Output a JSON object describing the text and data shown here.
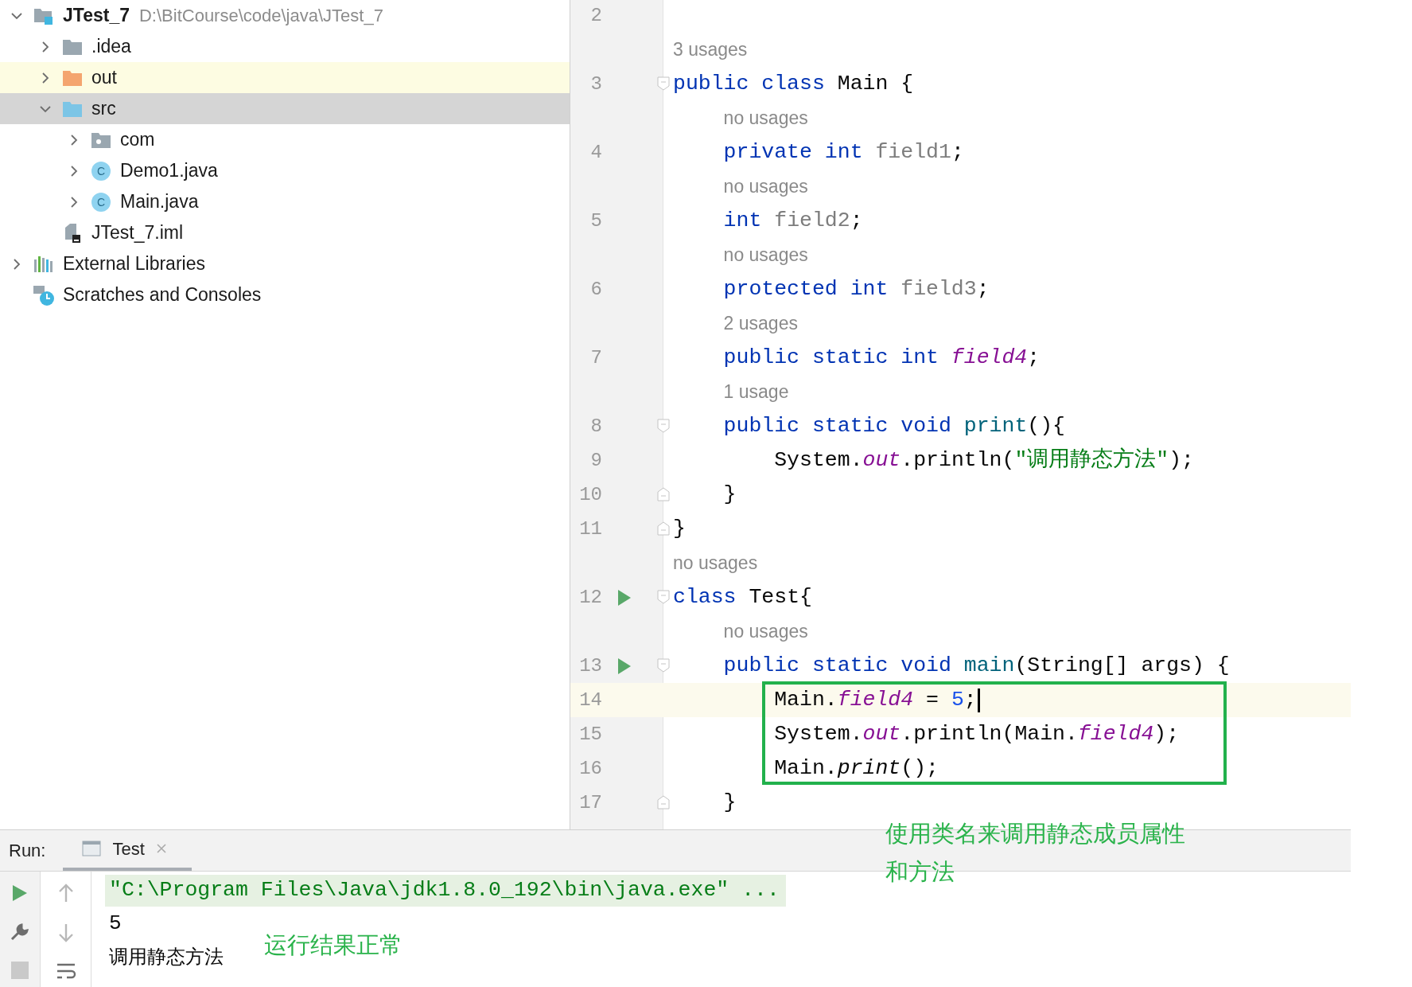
{
  "project_tree": [
    {
      "name": "JTest_7",
      "path": "D:\\BitCourse\\code\\java\\JTest_7",
      "kind": "project",
      "expanded": true,
      "selected": false,
      "highlighted": false,
      "children": [
        {
          "name": ".idea",
          "kind": "folder",
          "expanded": false,
          "selected": false,
          "highlighted": false
        },
        {
          "name": "out",
          "kind": "excluded_folder",
          "expanded": false,
          "selected": false,
          "highlighted": true
        },
        {
          "name": "src",
          "kind": "source_folder",
          "expanded": true,
          "selected": true,
          "children": [
            {
              "name": "com",
              "kind": "package",
              "expanded": false,
              "selected": false,
              "highlighted": false
            },
            {
              "name": "Demo1.java",
              "kind": "class",
              "badge": "C",
              "expanded": false,
              "selected": false,
              "highlighted": false
            },
            {
              "name": "Main.java",
              "kind": "class",
              "badge": "C",
              "expanded": false,
              "selected": false,
              "highlighted": false
            }
          ]
        },
        {
          "name": "JTest_7.iml",
          "kind": "module_file",
          "selected": false,
          "highlighted": false
        }
      ]
    },
    {
      "name": "External Libraries",
      "kind": "libraries",
      "expanded": false,
      "selected": false,
      "highlighted": false
    },
    {
      "name": "Scratches and Consoles",
      "kind": "scratches",
      "selected": false,
      "highlighted": false
    }
  ],
  "editor": {
    "rows": [
      {
        "kind": "code",
        "number": "2",
        "current": false,
        "run_marker": false,
        "tokens": []
      },
      {
        "kind": "hint",
        "text": "3 usages"
      },
      {
        "kind": "code",
        "number": "3",
        "current": false,
        "run_marker": false,
        "fold_start": true,
        "tokens": [
          {
            "text": "public class ",
            "kind": "keyword"
          },
          {
            "text": "Main {",
            "kind": "plain"
          }
        ]
      },
      {
        "kind": "hint",
        "text": "no usages"
      },
      {
        "kind": "code",
        "number": "4",
        "current": false,
        "run_marker": false,
        "tokens": [
          {
            "text": "    private int ",
            "kind": "keyword"
          },
          {
            "text": "field1",
            "kind": "unused"
          },
          {
            "text": ";",
            "kind": "plain"
          }
        ]
      },
      {
        "kind": "hint",
        "text": "no usages"
      },
      {
        "kind": "code",
        "number": "5",
        "current": false,
        "run_marker": false,
        "tokens": [
          {
            "text": "    int ",
            "kind": "keyword"
          },
          {
            "text": "field2",
            "kind": "unused"
          },
          {
            "text": ";",
            "kind": "plain"
          }
        ]
      },
      {
        "kind": "hint",
        "text": "no usages"
      },
      {
        "kind": "code",
        "number": "6",
        "current": false,
        "run_marker": false,
        "tokens": [
          {
            "text": "    protected int ",
            "kind": "keyword"
          },
          {
            "text": "field3",
            "kind": "unused"
          },
          {
            "text": ";",
            "kind": "plain"
          }
        ]
      },
      {
        "kind": "hint",
        "text": "2 usages"
      },
      {
        "kind": "code",
        "number": "7",
        "current": false,
        "run_marker": false,
        "tokens": [
          {
            "text": "    public static int ",
            "kind": "keyword"
          },
          {
            "text": "field4",
            "kind": "static"
          },
          {
            "text": ";",
            "kind": "plain"
          }
        ]
      },
      {
        "kind": "hint",
        "text": "1 usage"
      },
      {
        "kind": "code",
        "number": "8",
        "current": false,
        "run_marker": false,
        "fold_start": true,
        "tokens": [
          {
            "text": "    public static void ",
            "kind": "keyword"
          },
          {
            "text": "print",
            "kind": "method"
          },
          {
            "text": "(){",
            "kind": "plain"
          }
        ]
      },
      {
        "kind": "code",
        "number": "9",
        "current": false,
        "run_marker": false,
        "tokens": [
          {
            "text": "        System.",
            "kind": "plain"
          },
          {
            "text": "out",
            "kind": "static"
          },
          {
            "text": ".println(",
            "kind": "plain"
          },
          {
            "text": "\"调用静态方法\"",
            "kind": "string"
          },
          {
            "text": ");",
            "kind": "plain"
          }
        ]
      },
      {
        "kind": "code",
        "number": "10",
        "current": false,
        "run_marker": false,
        "fold_end": true,
        "tokens": [
          {
            "text": "    }",
            "kind": "plain"
          }
        ]
      },
      {
        "kind": "code",
        "number": "11",
        "current": false,
        "run_marker": false,
        "fold_end": true,
        "tokens": [
          {
            "text": "}",
            "kind": "plain"
          }
        ]
      },
      {
        "kind": "hint",
        "text": "no usages"
      },
      {
        "kind": "code",
        "number": "12",
        "current": false,
        "run_marker": true,
        "fold_start": true,
        "tokens": [
          {
            "text": "class ",
            "kind": "keyword"
          },
          {
            "text": "Test{",
            "kind": "plain"
          }
        ]
      },
      {
        "kind": "hint",
        "text": "no usages"
      },
      {
        "kind": "code",
        "number": "13",
        "current": false,
        "run_marker": true,
        "fold_start": true,
        "tokens": [
          {
            "text": "    public static void ",
            "kind": "keyword"
          },
          {
            "text": "main",
            "kind": "method"
          },
          {
            "text": "(String[] args) {",
            "kind": "plain"
          }
        ]
      },
      {
        "kind": "code",
        "number": "14",
        "current": true,
        "run_marker": false,
        "tokens": [
          {
            "text": "        Main.",
            "kind": "plain"
          },
          {
            "text": "field4",
            "kind": "static"
          },
          {
            "text": " = ",
            "kind": "plain"
          },
          {
            "text": "5",
            "kind": "number"
          },
          {
            "text": ";",
            "kind": "plain"
          }
        ]
      },
      {
        "kind": "code",
        "number": "15",
        "current": false,
        "run_marker": false,
        "tokens": [
          {
            "text": "        System.",
            "kind": "plain"
          },
          {
            "text": "out",
            "kind": "static"
          },
          {
            "text": ".println(Main.",
            "kind": "plain"
          },
          {
            "text": "field4",
            "kind": "static"
          },
          {
            "text": ");",
            "kind": "plain"
          }
        ]
      },
      {
        "kind": "code",
        "number": "16",
        "current": false,
        "run_marker": false,
        "tokens": [
          {
            "text": "        Main.",
            "kind": "plain"
          },
          {
            "text": "print",
            "kind": "italic"
          },
          {
            "text": "();",
            "kind": "plain"
          }
        ]
      },
      {
        "kind": "code",
        "number": "17",
        "current": false,
        "run_marker": false,
        "fold_end": true,
        "tokens": [
          {
            "text": "    }",
            "kind": "plain"
          }
        ]
      }
    ]
  },
  "run_panel": {
    "label": "Run:",
    "tabs": [
      {
        "label": "Test",
        "selected": true
      }
    ],
    "console": [
      {
        "text": "\"C:\\Program Files\\Java\\jdk1.8.0_192\\bin\\java.exe\" ...",
        "kind": "command"
      },
      {
        "text": "5",
        "kind": "output"
      },
      {
        "text": "调用静态方法",
        "kind": "output_cjk"
      }
    ]
  },
  "annotations": {
    "code_note": [
      "使用类名来调用静态成员属性",
      "和方法"
    ],
    "result_note": "运行结果正常"
  }
}
